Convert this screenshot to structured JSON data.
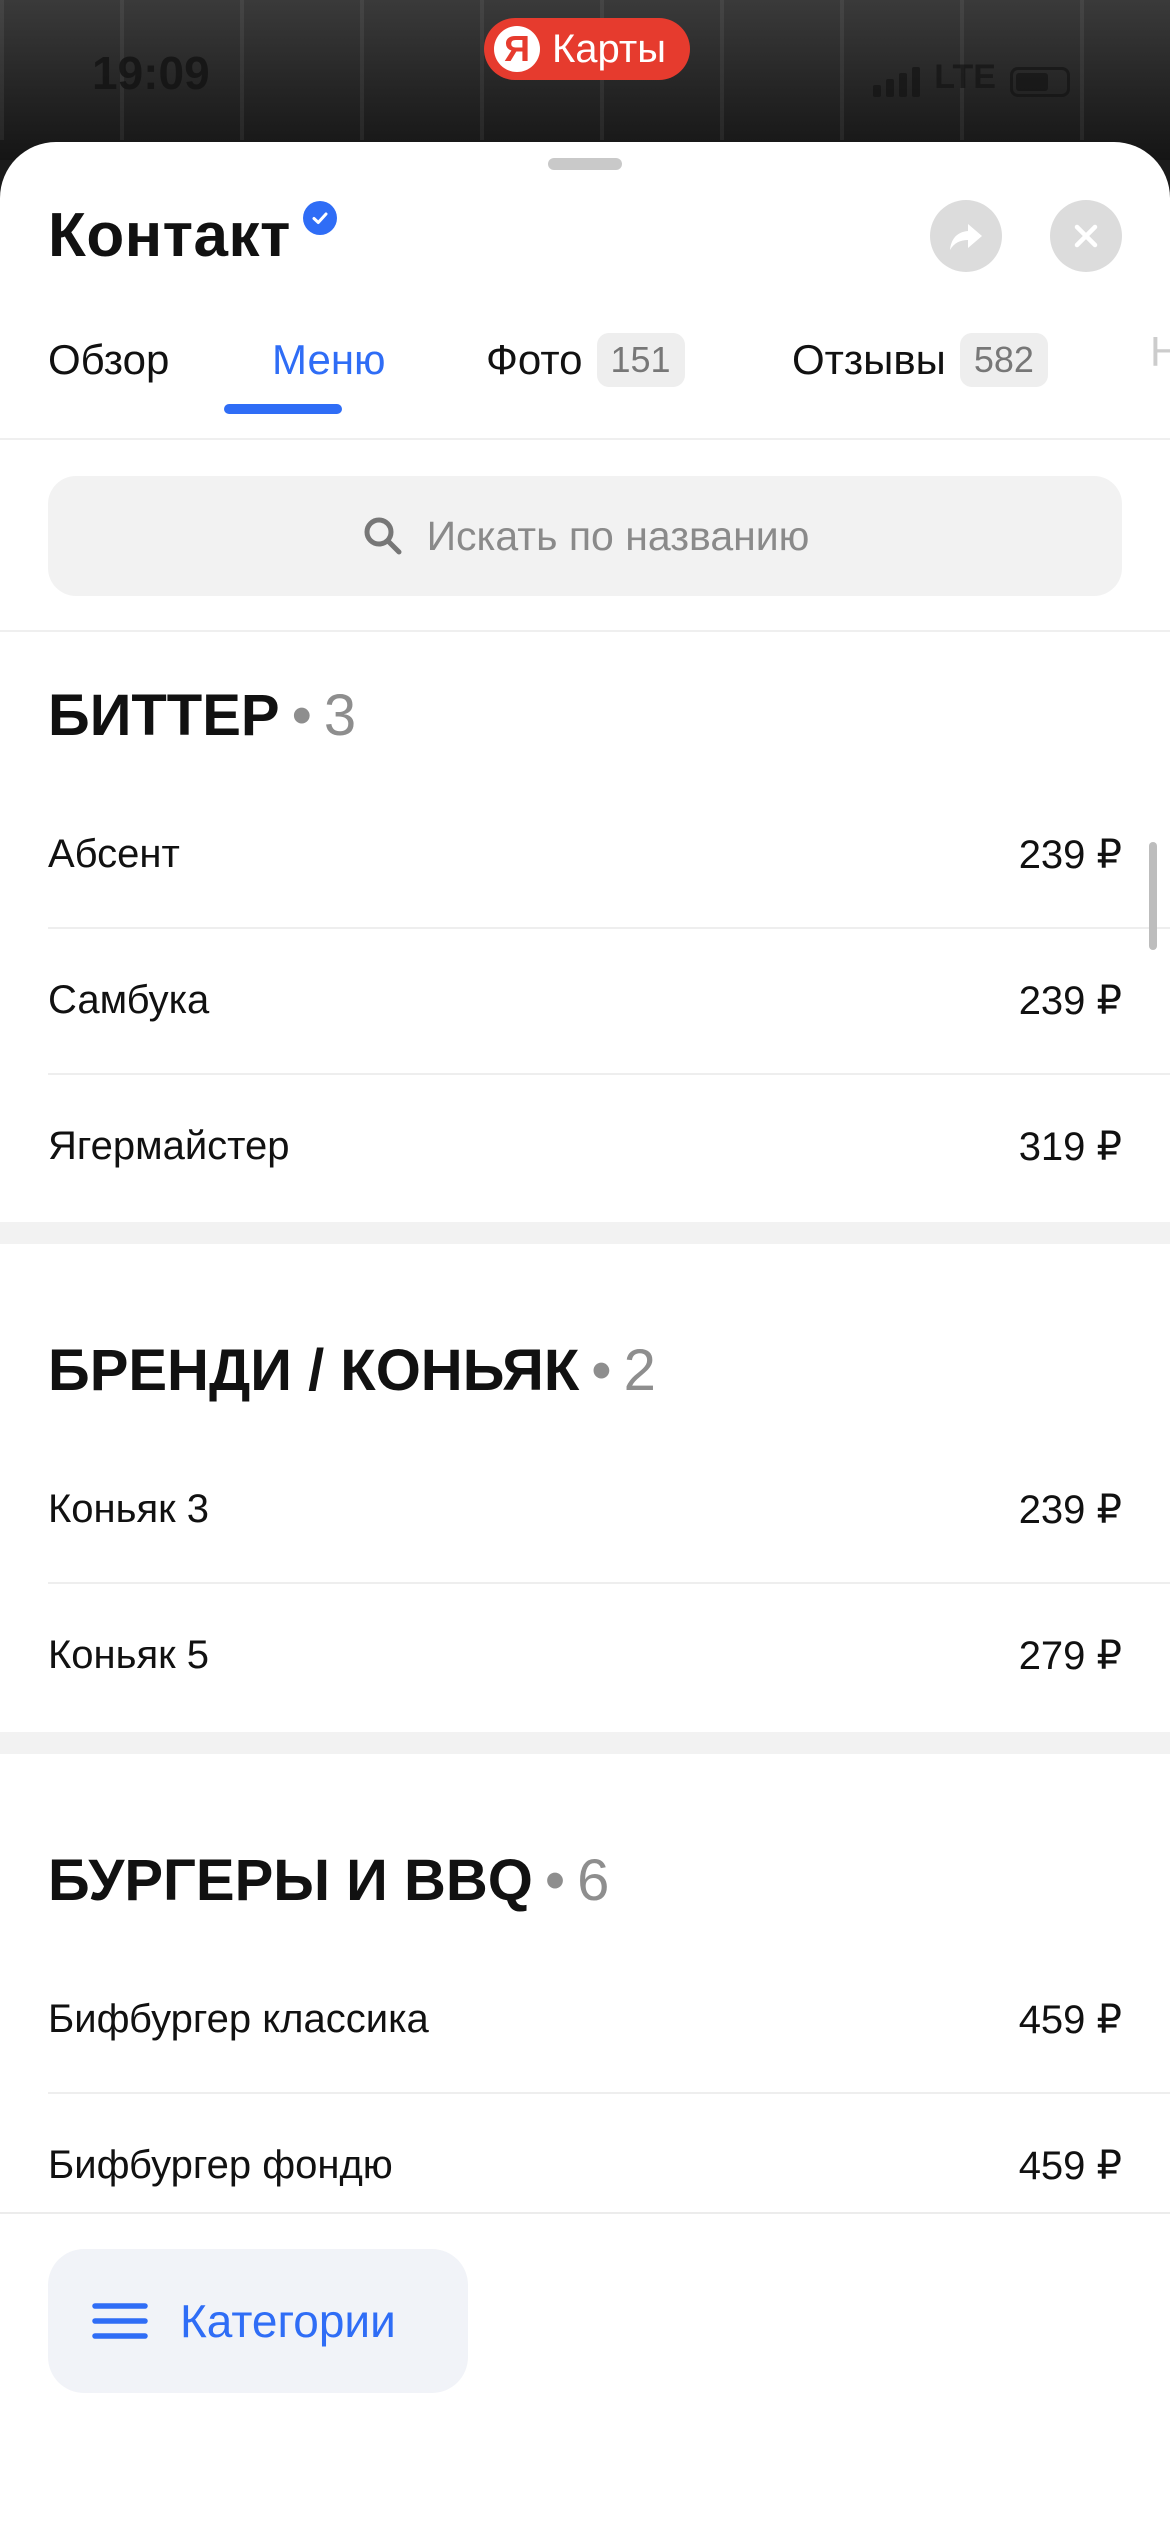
{
  "status": {
    "time": "19:09",
    "network": "LTE"
  },
  "brand": {
    "logo_letter": "Я",
    "name": "Карты",
    "color": "#e63b2e"
  },
  "place": {
    "title": "Контакт",
    "verified": true
  },
  "tabs": [
    {
      "label": "Обзор",
      "badge": ""
    },
    {
      "label": "Меню",
      "badge": "",
      "active": true
    },
    {
      "label": "Фото",
      "badge": "151"
    },
    {
      "label": "Отзывы",
      "badge": "582"
    },
    {
      "label": "Н",
      "badge": ""
    }
  ],
  "search": {
    "placeholder": "Искать по названию"
  },
  "sections": [
    {
      "title": "БИТТЕР",
      "count": "3",
      "items": [
        {
          "name": "Абсент",
          "price": "239 ₽"
        },
        {
          "name": "Самбука",
          "price": "239 ₽"
        },
        {
          "name": "Ягермайстер",
          "price": "319 ₽"
        }
      ]
    },
    {
      "title": "БРЕНДИ / КОНЬЯК",
      "count": "2",
      "items": [
        {
          "name": "Коньяк 3",
          "price": "239 ₽"
        },
        {
          "name": "Коньяк 5",
          "price": "279 ₽"
        }
      ]
    },
    {
      "title": "БУРГЕРЫ И BBQ",
      "count": "6",
      "items": [
        {
          "name": "Бифбургер классика",
          "price": "459 ₽"
        },
        {
          "name": "Бифбургер фондю",
          "price": "459 ₽"
        }
      ]
    }
  ],
  "categories_button": {
    "label": "Категории"
  },
  "colors": {
    "accent": "#2f6df6",
    "muted": "#8e8e8e"
  }
}
